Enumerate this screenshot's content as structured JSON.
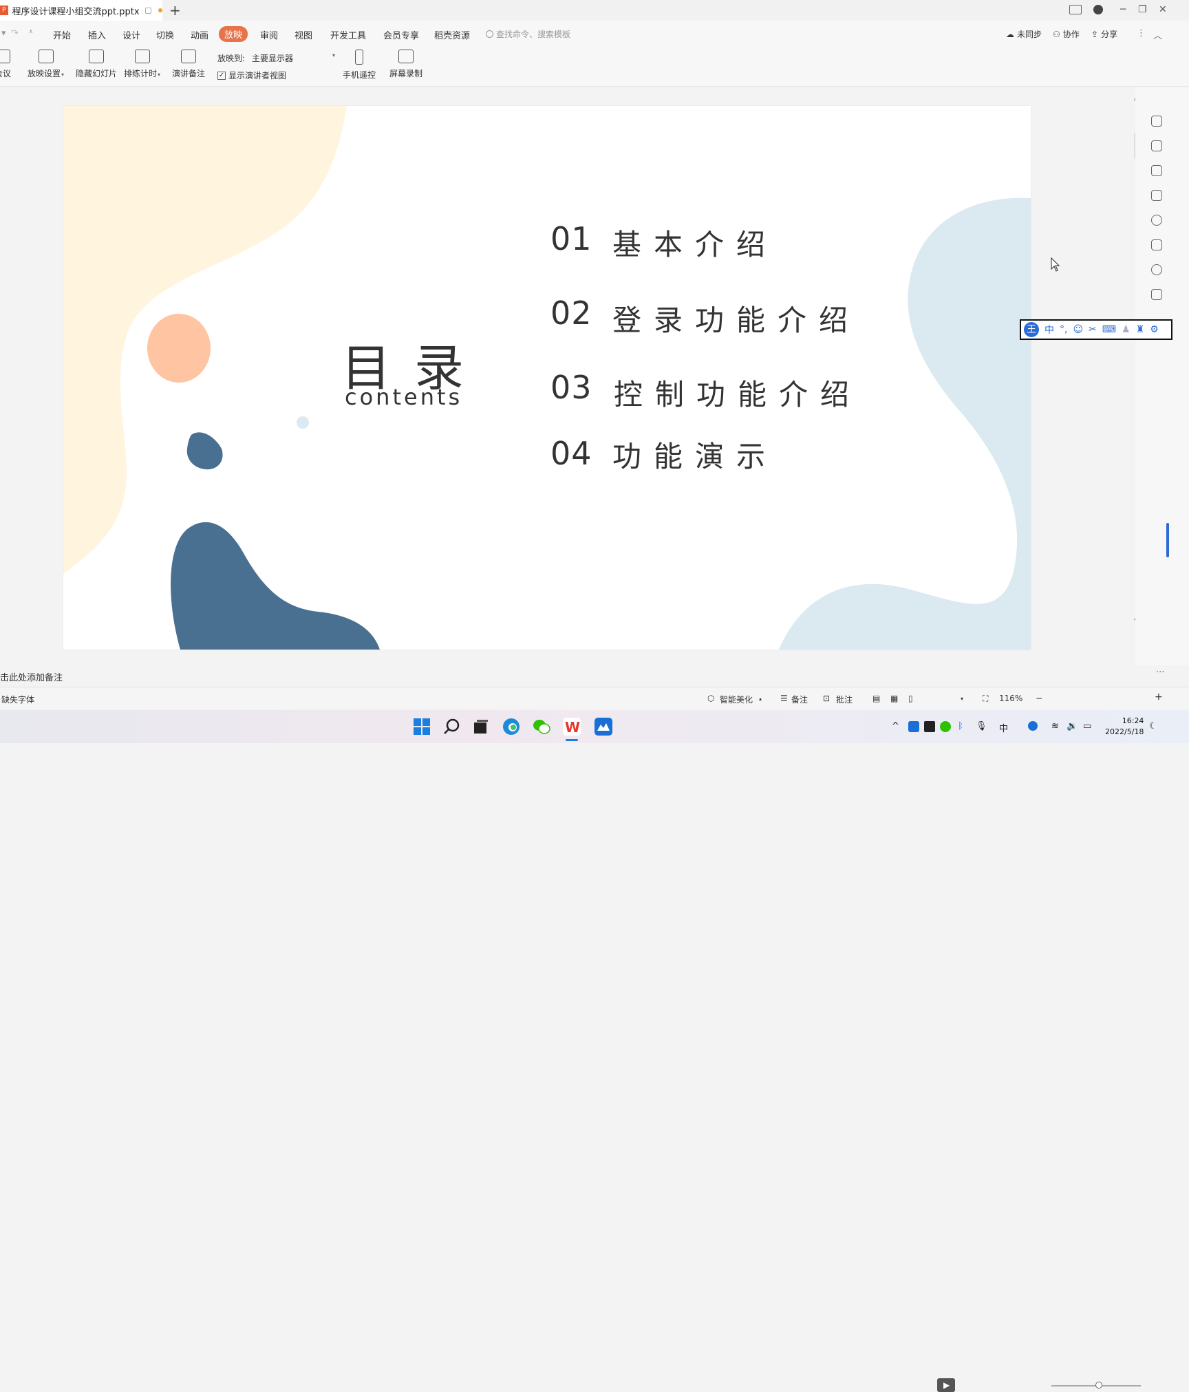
{
  "window": {
    "tab_title": "程序设计课程小组交流ppt.pptx",
    "ppt_badge": "P"
  },
  "menu": {
    "items": [
      "开始",
      "插入",
      "设计",
      "切换",
      "动画",
      "放映",
      "审阅",
      "视图",
      "开发工具",
      "会员专享",
      "稻壳资源"
    ],
    "active": "放映",
    "search_placeholder": "查找命令、搜索模板",
    "sync": "未同步",
    "collab": "协作",
    "share": "分享"
  },
  "ribbon": {
    "meeting": "会议",
    "show_settings": "放映设置",
    "hide_slide": "隐藏幻灯片",
    "rehearse": "排练计时",
    "speaker_notes": "演讲备注",
    "project_to_label": "放映到:",
    "project_to_value": "主要显示器",
    "presenter_view": "显示演讲者视图",
    "phone_remote": "手机遥控",
    "screen_record": "屏幕录制"
  },
  "slide": {
    "title": "目录",
    "subtitle": "contents",
    "toc": [
      {
        "num": "01",
        "text": "基本介绍"
      },
      {
        "num": "02",
        "text": "登录功能介绍"
      },
      {
        "num": "03",
        "text": "控制功能介绍"
      },
      {
        "num": "04",
        "text": "功能演示"
      }
    ],
    "colors": {
      "cream": "#fff5df",
      "peach": "#ffc4a2",
      "navy": "#4a7091",
      "light_blue": "#dbe9f0",
      "dot_blue": "#dde9f2"
    }
  },
  "ime": {
    "logo": "王",
    "mode": "中"
  },
  "notes": {
    "placeholder": "击此处添加备注"
  },
  "status": {
    "missing_font": "缺失字体",
    "beautify": "智能美化",
    "notes": "备注",
    "comments": "批注",
    "zoom": "116%"
  },
  "clock": {
    "time": "16:24",
    "date": "2022/5/18"
  }
}
